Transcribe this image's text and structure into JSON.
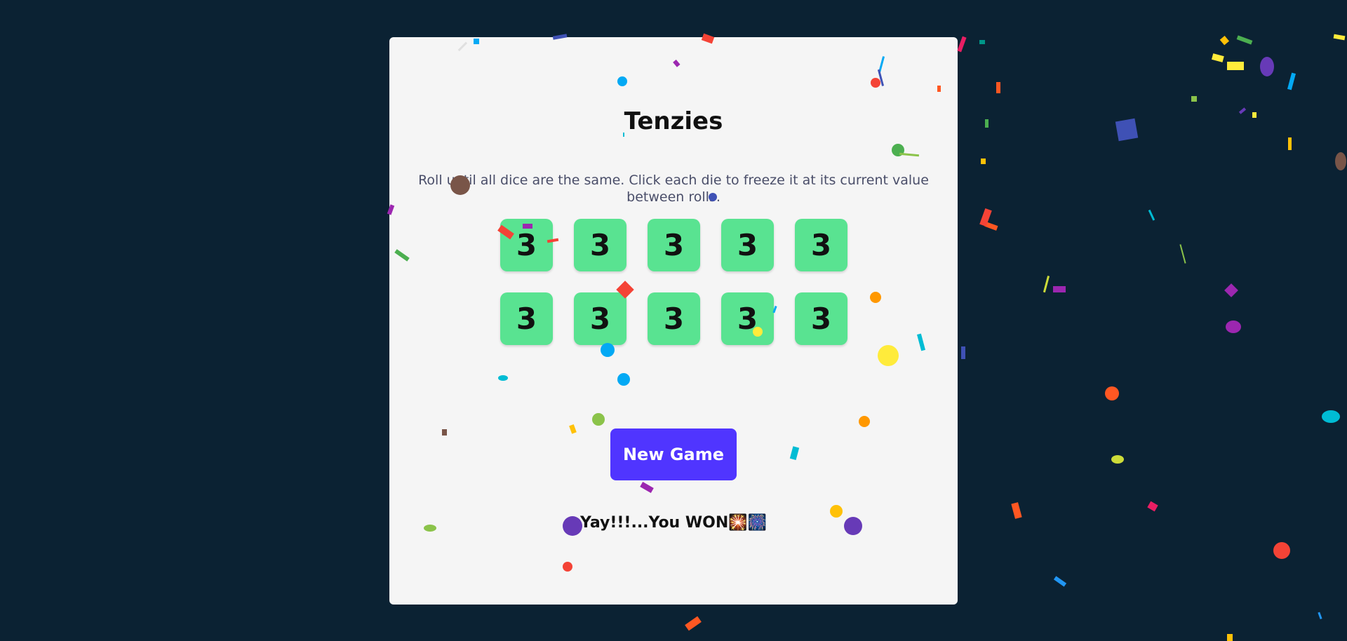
{
  "app": {
    "title": "Tenzies",
    "instructions": "Roll until all dice are the same. Click each die to freeze it at its current value between rolls.",
    "dice": [
      {
        "value": "3",
        "held": true
      },
      {
        "value": "3",
        "held": true
      },
      {
        "value": "3",
        "held": true
      },
      {
        "value": "3",
        "held": true
      },
      {
        "value": "3",
        "held": true
      },
      {
        "value": "3",
        "held": true
      },
      {
        "value": "3",
        "held": true
      },
      {
        "value": "3",
        "held": true
      },
      {
        "value": "3",
        "held": true
      },
      {
        "value": "3",
        "held": true
      }
    ],
    "new_game_label": "New Game",
    "win_message": "Yay!!!...You WON🎇🎆"
  },
  "colors": {
    "background": "#0b2233",
    "card": "#f5f5f5",
    "die_held": "#59e391",
    "button": "#5035ff"
  }
}
